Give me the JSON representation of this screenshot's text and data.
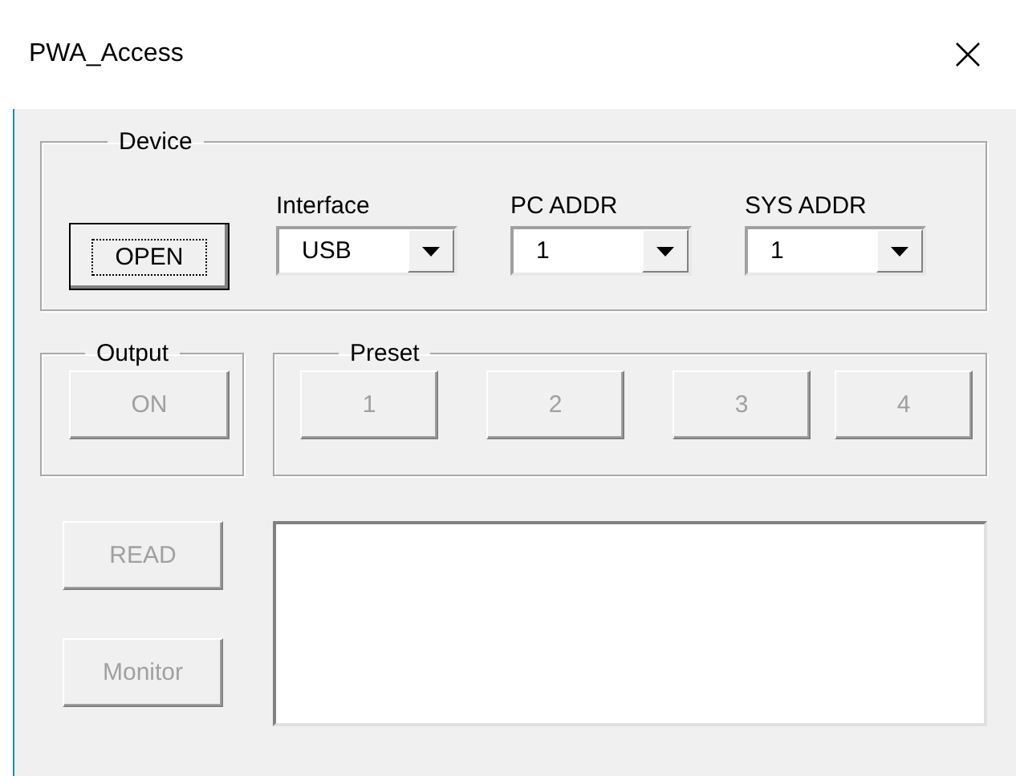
{
  "window": {
    "title": "PWA_Access"
  },
  "device": {
    "label": "Device",
    "open_button": {
      "label": "OPEN",
      "focused": true,
      "disabled": false
    },
    "dropdowns": [
      {
        "label": "Interface",
        "value": "USB"
      },
      {
        "label": "PC ADDR",
        "value": "1"
      },
      {
        "label": "SYS ADDR",
        "value": "1"
      }
    ]
  },
  "output": {
    "label": "Output",
    "buttons": [
      {
        "label": "ON",
        "disabled": true
      }
    ]
  },
  "preset": {
    "label": "Preset",
    "buttons": [
      {
        "label": "1",
        "disabled": true
      },
      {
        "label": "2",
        "disabled": true
      },
      {
        "label": "3",
        "disabled": true
      },
      {
        "label": "4",
        "disabled": true
      }
    ]
  },
  "actions": [
    {
      "label": "READ",
      "disabled": true
    },
    {
      "label": "Monitor",
      "disabled": true
    }
  ]
}
